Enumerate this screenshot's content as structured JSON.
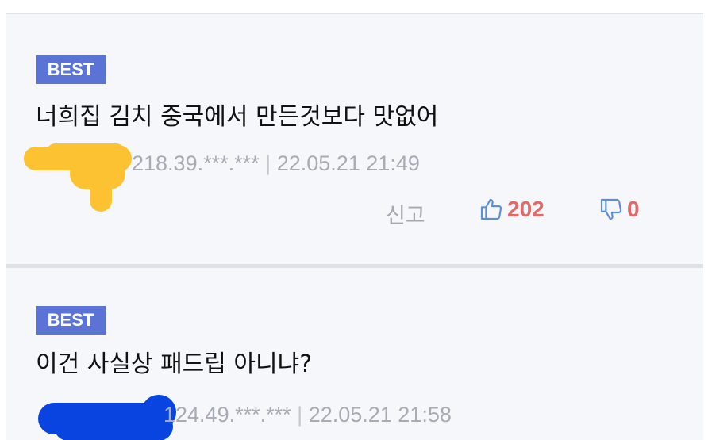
{
  "comments": [
    {
      "badge": "BEST",
      "text": "너희집 김치 중국에서 만든것보다 맛없어",
      "ip": "218.39.***.***",
      "separator": "|",
      "datetime": "22.05.21 21:49",
      "report_label": "신고",
      "likes": "202",
      "dislikes": "0",
      "redaction_color": "#fcc232"
    },
    {
      "badge": "BEST",
      "text": "이건 사실상 패드립 아니냐?",
      "ip": "124.49.***.***",
      "separator": "|",
      "datetime": "22.05.21 21:58",
      "redaction_color": "#0a44e0"
    }
  ],
  "icons": {
    "like": "thumbs-up-icon",
    "dislike": "thumbs-down-icon"
  },
  "colors": {
    "badge": "#5b73d4",
    "count": "#e06a6a",
    "icon": "#5b8fdc"
  }
}
